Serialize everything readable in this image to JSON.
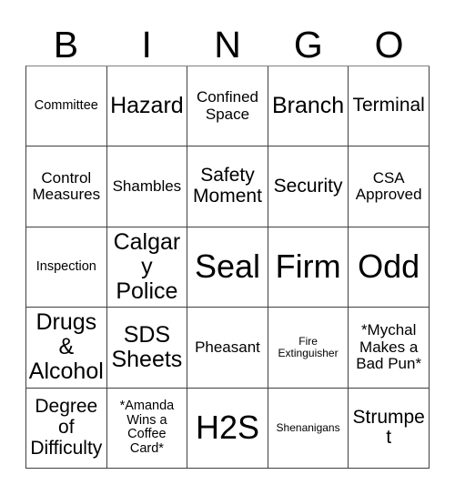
{
  "card": {
    "header_letters": [
      "B",
      "I",
      "N",
      "G",
      "O"
    ],
    "rows": [
      [
        {
          "text": "Committee",
          "size": "fs-sm"
        },
        {
          "text": "Hazard",
          "size": "fs-xl"
        },
        {
          "text": "Confined\nSpace",
          "size": "fs-md"
        },
        {
          "text": "Branch",
          "size": "fs-xl"
        },
        {
          "text": "Terminal",
          "size": "fs-lg"
        }
      ],
      [
        {
          "text": "Control\nMeasures",
          "size": "fs-md"
        },
        {
          "text": "Shambles",
          "size": "fs-md"
        },
        {
          "text": "Safety\nMoment",
          "size": "fs-lg"
        },
        {
          "text": "Security",
          "size": "fs-lg"
        },
        {
          "text": "CSA\nApproved",
          "size": "fs-md"
        }
      ],
      [
        {
          "text": "Inspection",
          "size": "fs-sm"
        },
        {
          "text": "Calgary\nPolice",
          "size": "fs-xl"
        },
        {
          "text": "Seal",
          "size": "fs-xxl"
        },
        {
          "text": "Firm",
          "size": "fs-xxl"
        },
        {
          "text": "Odd",
          "size": "fs-xxl"
        }
      ],
      [
        {
          "text": "Drugs\n&\nAlcohol",
          "size": "fs-xl"
        },
        {
          "text": "SDS\nSheets",
          "size": "fs-xl"
        },
        {
          "text": "Pheasant",
          "size": "fs-md"
        },
        {
          "text": "Fire\nExtinguisher",
          "size": "fs-xs"
        },
        {
          "text": "*Mychal\nMakes a\nBad Pun*",
          "size": "fs-md"
        }
      ],
      [
        {
          "text": "Degree\nof\nDifficulty",
          "size": "fs-lg"
        },
        {
          "text": "*Amanda\nWins a\nCoffee\nCard*",
          "size": "fs-sm"
        },
        {
          "text": "H2S",
          "size": "fs-xxl"
        },
        {
          "text": "Shenanigans",
          "size": "fs-xs"
        },
        {
          "text": "Strumpet",
          "size": "fs-lg"
        }
      ]
    ]
  },
  "colors": {
    "background": "#ffffff",
    "text": "#000000",
    "grid_line": "#404040"
  }
}
